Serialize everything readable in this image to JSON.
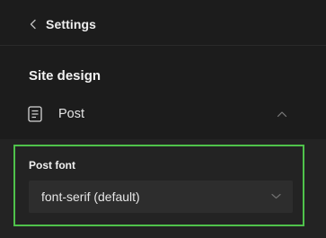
{
  "header": {
    "back_label": "Settings",
    "back_icon": "chevron-left-icon"
  },
  "section": {
    "title": "Site design"
  },
  "post_item": {
    "label": "Post",
    "icon": "document-icon",
    "expanded": true
  },
  "post_font": {
    "label": "Post font",
    "selected": "font-serif (default)",
    "highlight_color": "#4fc24b"
  },
  "colors": {
    "background": "#1c1c1c",
    "panel": "#232323",
    "select_bg": "#2d2d2d",
    "text": "#e8e8e8",
    "icon": "#9a9a9a"
  }
}
